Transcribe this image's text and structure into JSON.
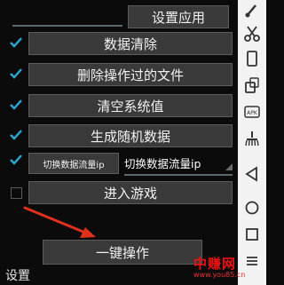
{
  "buttons": {
    "settings_app": "设置应用",
    "clear_data": "数据清除",
    "delete_files": "删除操作过的文件",
    "clear_system": "清空系统值",
    "gen_random": "生成随机数据",
    "switch_ip": "切换数据流量ip",
    "enter_game": "进入游戏",
    "one_click": "一键操作"
  },
  "ip_selected": "切换数据流量ip",
  "bottom_label": "设置",
  "checkboxes": [
    true,
    true,
    true,
    true,
    true,
    false
  ],
  "watermark": {
    "brand": "中赚网",
    "url": "www.you85.cn"
  },
  "colors": {
    "accent": "#2aa7d6",
    "arrow": "#e0301e",
    "button_bg": "#3a3a3a"
  },
  "sidebar_icons": [
    "paint-brush-icon",
    "scissors-icon",
    "phone-icon",
    "rotate-device-icon",
    "apk-icon",
    "broom-icon",
    "back-icon",
    "home-icon",
    "recents-icon",
    "menu-icon"
  ]
}
